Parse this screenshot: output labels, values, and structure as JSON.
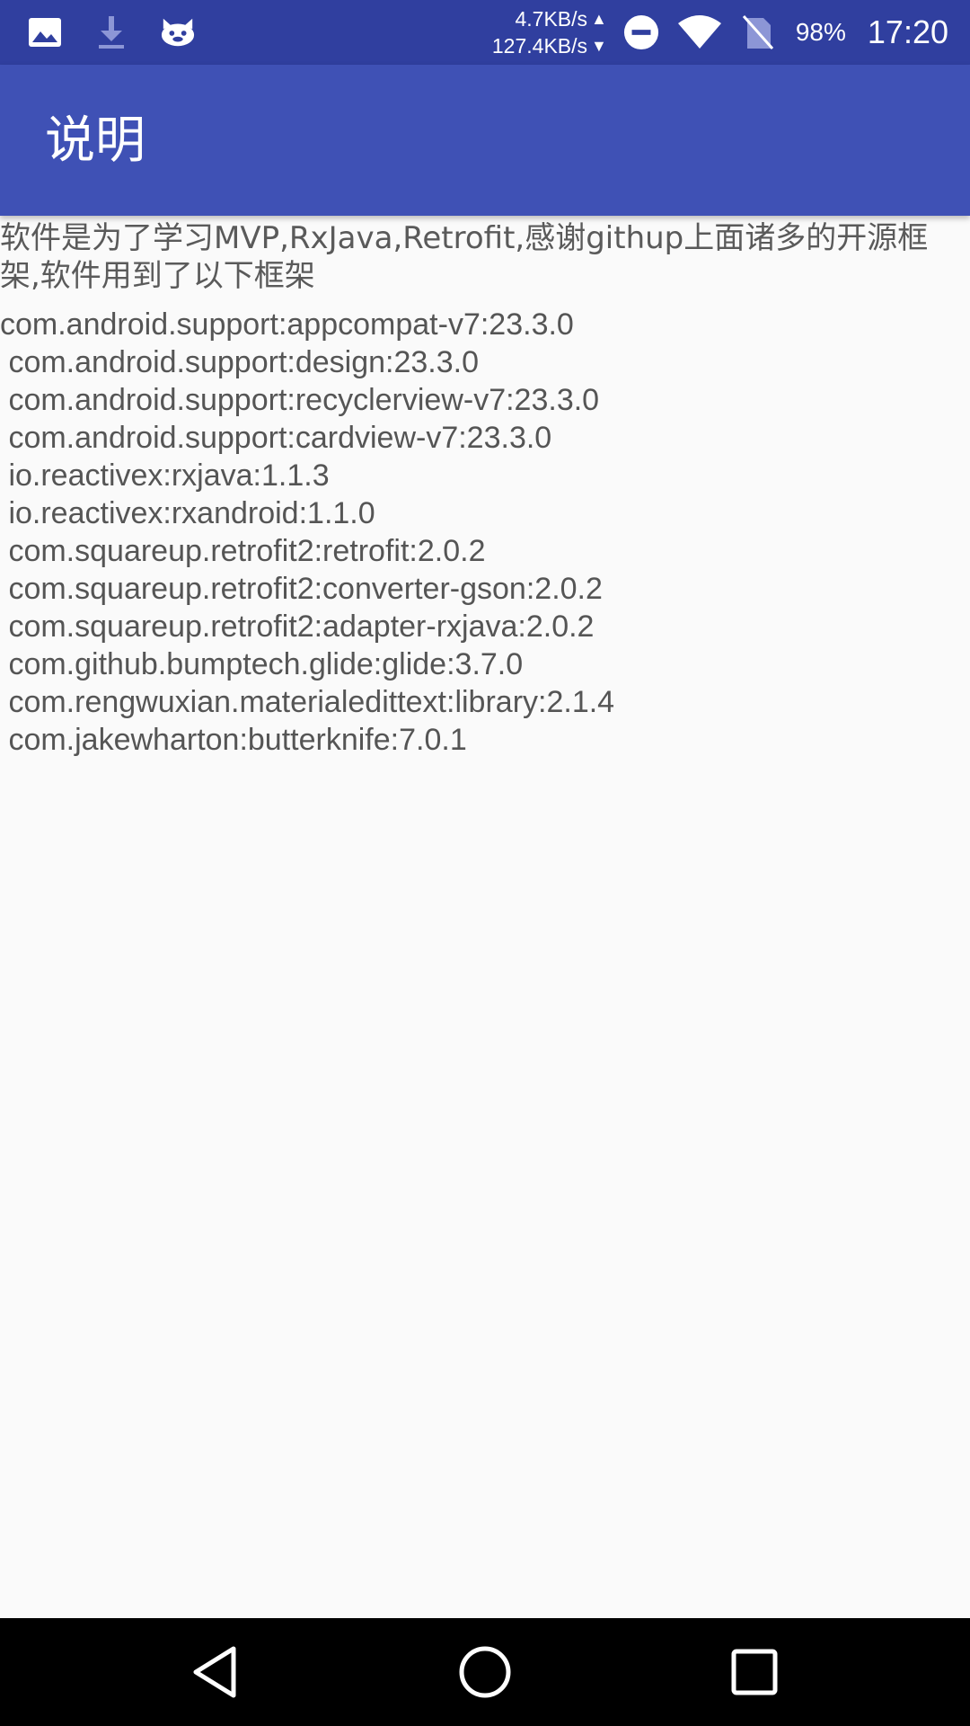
{
  "status_bar": {
    "notification_icons": [
      "image-icon",
      "download-icon",
      "cat-app-icon"
    ],
    "net_up": "4.7KB/s",
    "net_down": "127.4KB/s",
    "battery": "98%",
    "time": "17:20"
  },
  "toolbar": {
    "title": "说明"
  },
  "content": {
    "intro": "软件是为了学习MVP,RxJava,Retrofit,感谢githup上面诸多的开源框架,软件用到了以下框架",
    "libraries": [
      "com.android.support:appcompat-v7:23.3.0",
      " com.android.support:design:23.3.0",
      " com.android.support:recyclerview-v7:23.3.0",
      " com.android.support:cardview-v7:23.3.0",
      " io.reactivex:rxjava:1.1.3",
      " io.reactivex:rxandroid:1.1.0",
      " com.squareup.retrofit2:retrofit:2.0.2",
      " com.squareup.retrofit2:converter-gson:2.0.2",
      " com.squareup.retrofit2:adapter-rxjava:2.0.2",
      " com.github.bumptech.glide:glide:3.7.0",
      " com.rengwuxian.materialedittext:library:2.1.4",
      " com.jakewharton:butterknife:7.0.1"
    ]
  },
  "nav_bar": {
    "buttons": [
      "back-icon",
      "home-icon",
      "recents-icon"
    ]
  },
  "colors": {
    "status_bar": "#303f9f",
    "toolbar": "#3f51b5",
    "background": "#fafafa",
    "text": "#555555",
    "nav_bar": "#000000"
  }
}
